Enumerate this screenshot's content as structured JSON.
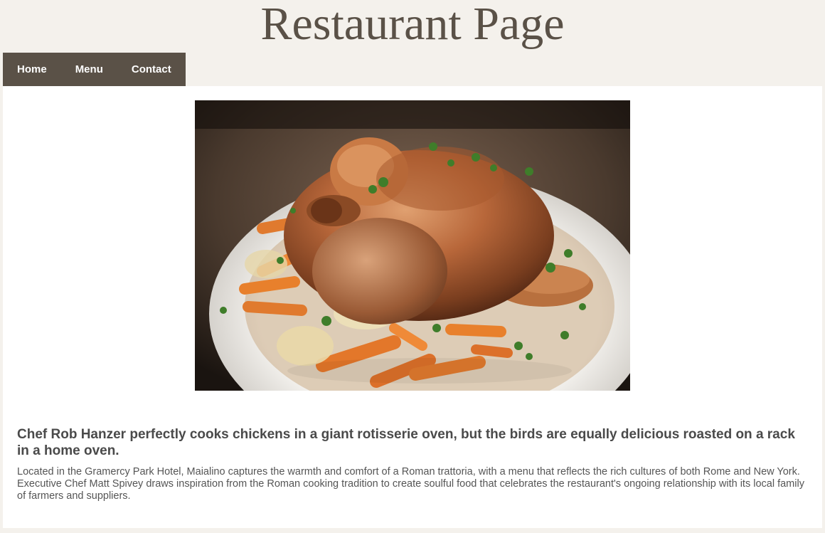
{
  "header": {
    "title": "Restaurant Page"
  },
  "nav": {
    "items": [
      {
        "label": "Home"
      },
      {
        "label": "Menu"
      },
      {
        "label": "Contact"
      }
    ]
  },
  "main": {
    "image_name": "roast-chicken-image",
    "headline": "Chef Rob Hanzer perfectly cooks chickens in a giant rotisserie oven, but the birds are equally delicious roasted on a rack in a home oven.",
    "paragraphs": [
      "Located in the Gramercy Park Hotel, Maialino captures the warmth and comfort of a Roman trattoria, with a menu that reflects the rich cultures of both Rome and New York.",
      "Executive Chef Matt Spivey draws inspiration from the Roman cooking tradition to create soulful food that celebrates the restaurant's ongoing relationship with its local family of farmers and suppliers."
    ]
  },
  "colors": {
    "page_background": "#f4f1ec",
    "nav_background": "#5a5147",
    "title_color": "#5a5147",
    "content_background": "#ffffff"
  }
}
